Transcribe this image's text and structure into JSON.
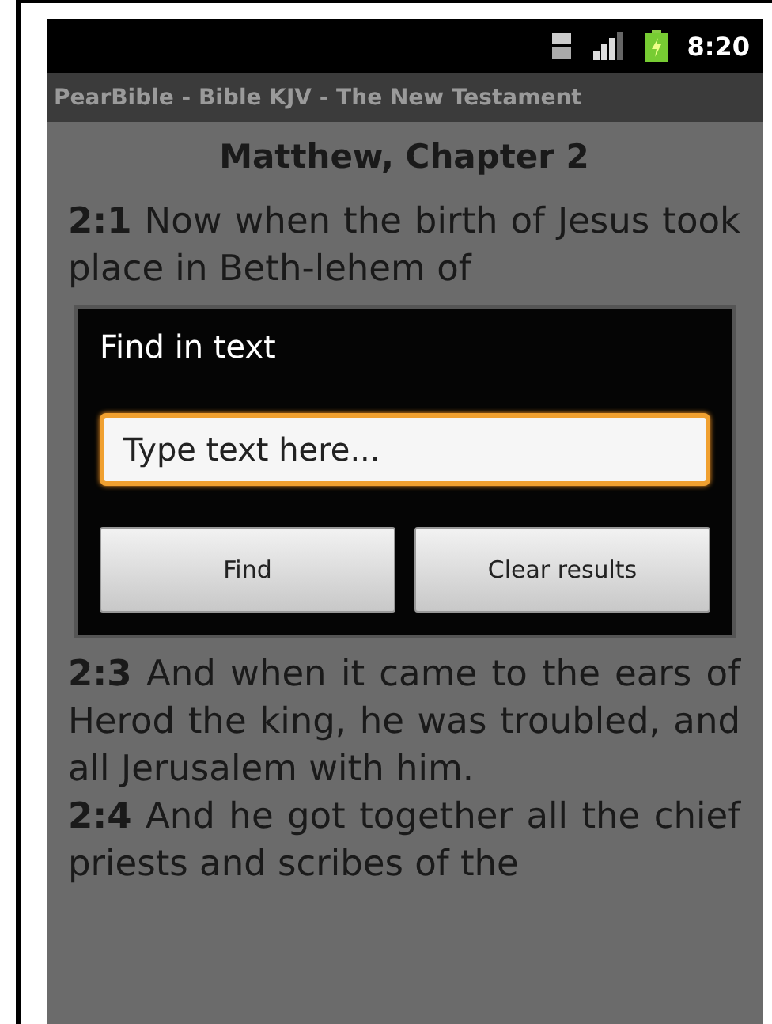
{
  "status_bar": {
    "time": "8:20"
  },
  "title_bar": {
    "title": "PearBible - Bible KJV - The New Testament"
  },
  "chapter_heading": "Matthew, Chapter 2",
  "verses_before": [
    {
      "text": "**2:1** Now when the birth of Jesus took place in Beth-lehem of"
    }
  ],
  "dialog": {
    "title": "Find in text",
    "search": {
      "placeholder": "Type text here..."
    },
    "buttons": [
      {
        "label": "Find"
      },
      {
        "label": "Clear results"
      }
    ]
  },
  "verses_after": [
    {
      "text": "**2:3** And when it came to the ears of Herod the king, he was troubled, and all Jerusalem with him."
    },
    {
      "text": "**2:4** And he got together all the chief priests and scribes of the"
    }
  ]
}
